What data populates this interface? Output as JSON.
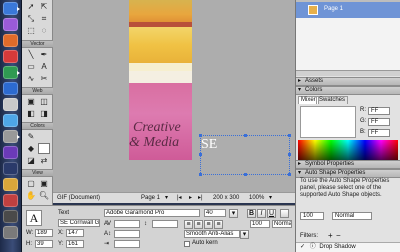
{
  "tools": {
    "sections": [
      "Vector",
      "Web",
      "Colors",
      "View"
    ]
  },
  "canvas": {
    "creative_text": "Creative",
    "media_text": "& Media",
    "se_text": "SE"
  },
  "status": {
    "doc_type": "GIF (Document)",
    "page": "Page 1",
    "size": "200 x 300",
    "zoom": "100%"
  },
  "properties": {
    "tool": "Text",
    "name": "SE Cornwall Gr...",
    "font": "Adobe Garamond Pro",
    "size": "40",
    "bold": "B",
    "italic": "I",
    "underline": "U",
    "w_label": "W:",
    "w": "189",
    "x_label": "X:",
    "x": "147",
    "h_label": "H:",
    "h": "39",
    "y_label": "Y:",
    "y": "161",
    "antialias": "Smooth Anti-Alias",
    "autokern": "Auto kern",
    "opacity": "100",
    "blend": "Normal",
    "filters": "Filters:",
    "effect": "Drop Shadow"
  },
  "right": {
    "page_label": "Page 1",
    "assets": "Assets",
    "colors": "Colors",
    "tab_mixer": "Mixer",
    "tab_swatches": "Swatches",
    "r_label": "R:",
    "g_label": "G:",
    "b_label": "B:",
    "r": "FF",
    "g": "FF",
    "b": "FF",
    "symbol_props": "Symbol Properties",
    "auto_shape_props": "Auto Shape Properties",
    "auto_shape_help": "To use the Auto Shape Properties panel, please select one of the supported Auto Shape objects.",
    "opacity": "100",
    "blend": "Normal",
    "filters_label": "Filters:",
    "drop_shadow": "Drop Shadow"
  }
}
